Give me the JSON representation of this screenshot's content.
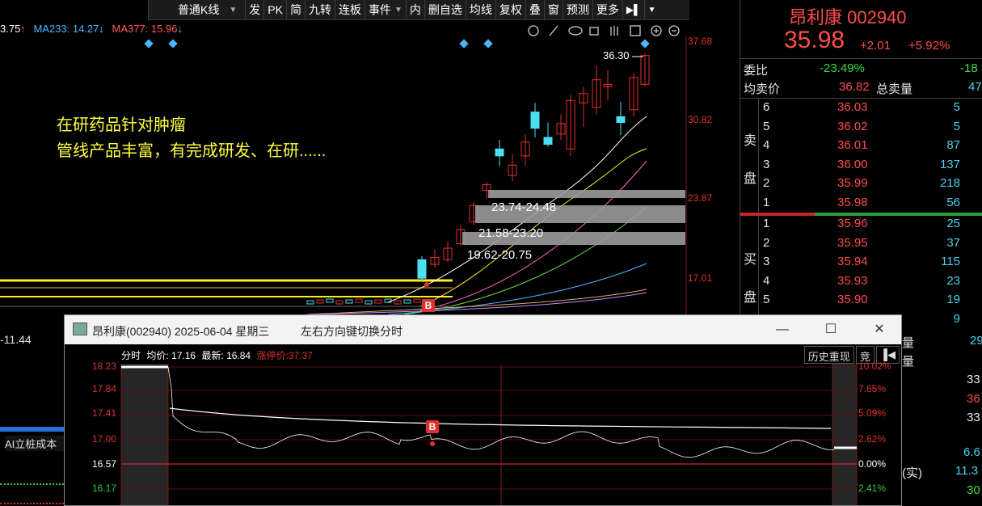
{
  "toolbar": {
    "items": [
      "普通K线",
      "发",
      "PK",
      "简",
      "九转",
      "连板",
      "事件",
      "内",
      "删自选",
      "均线",
      "复权",
      "叠",
      "窗",
      "预测",
      "更多"
    ],
    "dropdown": "▼",
    "end_icons": [
      "▶▌",
      "▼"
    ]
  },
  "ma_line": {
    "ma_a": "3.75",
    "ma_a_arrow": "↑",
    "ma233": "MA233: 14.27",
    "ma233_arrow": "↓",
    "ma377": "MA377: 15.96",
    "ma377_arrow": "↓"
  },
  "chart": {
    "peak_label": "36.30",
    "price_axis": [
      "37.68",
      "30.82",
      "23.87",
      "17.01"
    ],
    "annotation": [
      "在研药品针对肿瘤",
      "管线产品丰富，有完成研发、在研......"
    ],
    "zones": [
      "23.74-24.48",
      "21.58-23.20",
      "19.62-20.75"
    ],
    "b_marker": "B",
    "left_value": "-11.44",
    "ai_label": "AI立桩成本"
  },
  "quote": {
    "name": "昂利康 002940",
    "price": "35.98",
    "change": "+2.01",
    "change_pct": "+5.92%",
    "wei_bi_label": "委比",
    "wei_bi": "-23.49%",
    "wei_cha": "-18",
    "avg_label": "均卖价",
    "avg_price": "36.82",
    "total_label": "总卖量",
    "total_qty": "47",
    "sell_label": [
      "卖",
      "盘"
    ],
    "buy_label": [
      "买",
      "盘"
    ],
    "sell": [
      {
        "lv": "6",
        "price": "36.03",
        "qty": "5"
      },
      {
        "lv": "5",
        "price": "36.02",
        "qty": "5"
      },
      {
        "lv": "4",
        "price": "36.01",
        "qty": "87"
      },
      {
        "lv": "3",
        "price": "36.00",
        "qty": "137"
      },
      {
        "lv": "2",
        "price": "35.99",
        "qty": "218"
      },
      {
        "lv": "1",
        "price": "35.98",
        "qty": "56"
      }
    ],
    "buy": [
      {
        "lv": "1",
        "price": "35.96",
        "qty": "25"
      },
      {
        "lv": "2",
        "price": "35.95",
        "qty": "37"
      },
      {
        "lv": "3",
        "price": "35.94",
        "qty": "115"
      },
      {
        "lv": "4",
        "price": "35.93",
        "qty": "23"
      },
      {
        "lv": "5",
        "price": "35.90",
        "qty": "19"
      },
      {
        "lv": "",
        "price": "",
        "qty": "9"
      }
    ],
    "extra_rows": [
      {
        "label": "量",
        "value": "29"
      },
      {
        "label": "量",
        "value": ""
      },
      {
        "label": "",
        "value": "33"
      },
      {
        "label": "",
        "value": "36"
      },
      {
        "label": "",
        "value": "33"
      },
      {
        "label": "",
        "value": "6.6"
      },
      {
        "label": "(实)",
        "value": "11.3"
      },
      {
        "label": "",
        "value": "30"
      }
    ]
  },
  "popup": {
    "title": "昂利康(002940)  2025-06-04 星期三",
    "hint": "左右方向键切换分时",
    "min": "—",
    "max": "☐",
    "close": "✕",
    "info_label": "分时",
    "avg": "均价: 17.16",
    "latest": "最新: 16.84",
    "limit_up": "涨停价:37.37",
    "btn_history": "历史重现",
    "btn_jing": "竞",
    "btn_back": "▐◀",
    "y_left": [
      "18.23",
      "17.84",
      "17.41",
      "17.00",
      "16.57",
      "16.17"
    ],
    "y_right": [
      "10.02%",
      "7.65%",
      "5.09%",
      "2.62%",
      "0.00%",
      "2.41%"
    ],
    "b_marker": "B"
  },
  "colors": {
    "up": "#e0312e",
    "down": "#49d0f0",
    "annotation": "#ffff44",
    "zone": "#9a9a9a"
  }
}
